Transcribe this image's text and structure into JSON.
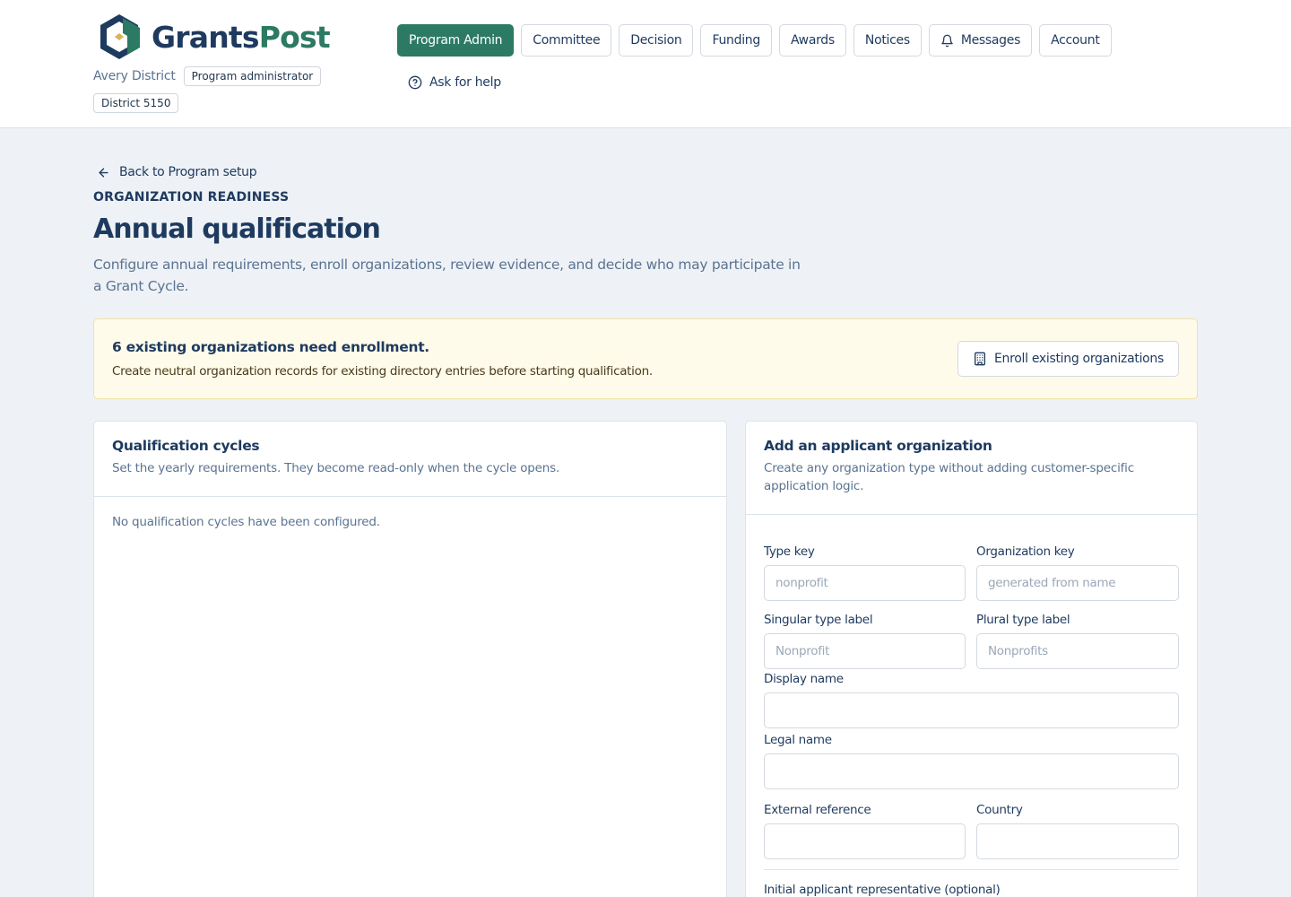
{
  "brand": {
    "name_part1": "Grants",
    "name_part2": "Post"
  },
  "district": {
    "name": "Avery District",
    "role": "Program administrator",
    "id": "District 5150"
  },
  "nav": {
    "items": [
      {
        "label": "Program Admin"
      },
      {
        "label": "Committee"
      },
      {
        "label": "Decision"
      },
      {
        "label": "Funding"
      },
      {
        "label": "Awards"
      },
      {
        "label": "Notices"
      },
      {
        "label": "Messages"
      },
      {
        "label": "Account"
      }
    ],
    "help": "Ask for help"
  },
  "page": {
    "back": "Back to Program setup",
    "eyebrow": "ORGANIZATION READINESS",
    "title": "Annual qualification",
    "subtitle": "Configure annual requirements, enroll organizations, review evidence, and decide who may participate in a Grant Cycle."
  },
  "notice": {
    "title": "6 existing organizations need enrollment.",
    "text": "Create neutral organization records for existing directory entries before starting qualification.",
    "button": "Enroll existing organizations"
  },
  "cycles": {
    "title": "Qualification cycles",
    "desc": "Set the yearly requirements. They become read-only when the cycle opens.",
    "empty": "No qualification cycles have been configured."
  },
  "add_org": {
    "title": "Add an applicant organization",
    "desc": "Create any organization type without adding customer-specific application logic.",
    "fields": {
      "type_key": {
        "label": "Type key",
        "placeholder": "nonprofit",
        "value": ""
      },
      "org_key": {
        "label": "Organization key",
        "placeholder": "generated from name",
        "value": ""
      },
      "singular": {
        "label": "Singular type label",
        "placeholder": "Nonprofit",
        "value": ""
      },
      "plural": {
        "label": "Plural type label",
        "placeholder": "Nonprofits",
        "value": ""
      },
      "display_name": {
        "label": "Display name",
        "placeholder": "",
        "value": ""
      },
      "legal_name": {
        "label": "Legal name",
        "placeholder": "",
        "value": ""
      },
      "external_ref": {
        "label": "External reference",
        "placeholder": "",
        "value": ""
      },
      "country": {
        "label": "Country",
        "placeholder": "",
        "value": ""
      }
    },
    "rep_label": "Initial applicant representative (optional)"
  },
  "colors": {
    "primary": "#2c7a63",
    "navy": "#1e3a5f",
    "muted": "#5b7391",
    "notice_bg": "#fefbea",
    "page_bg": "#eef2f6"
  }
}
